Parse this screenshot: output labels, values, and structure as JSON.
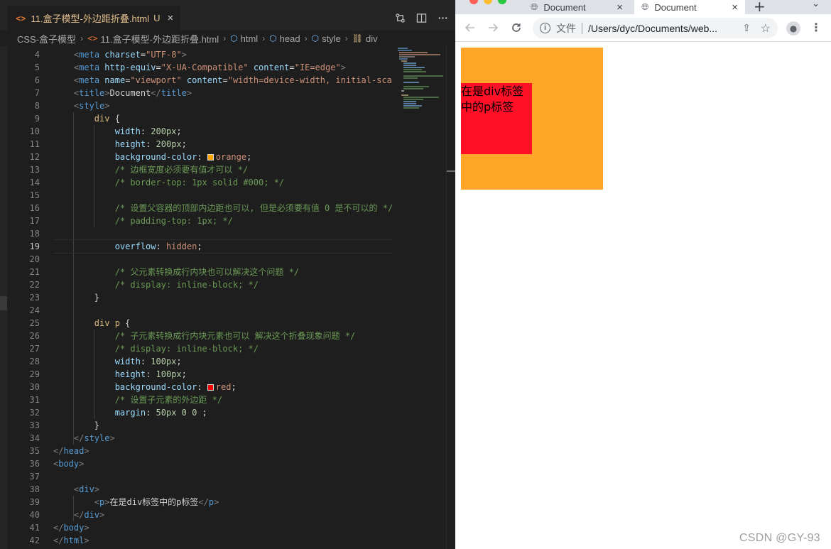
{
  "editor": {
    "tab": {
      "filename": "11.盒子模型-外边距折叠.html",
      "modified": "U",
      "close": "×"
    },
    "actions": [
      "compare",
      "split",
      "more"
    ],
    "breadcrumb": {
      "root": "CSS-盒子模型",
      "file": "11.盒子模型-外边距折叠.html",
      "items": [
        "html",
        "head",
        "style",
        "div"
      ]
    },
    "current_line": 19,
    "line_numbers": [
      "4",
      "5",
      "6",
      "7",
      "8",
      "9",
      "10",
      "11",
      "12",
      "13",
      "14",
      "15",
      "16",
      "17",
      "18",
      "19",
      "20",
      "21",
      "22",
      "23",
      "24",
      "25",
      "26",
      "27",
      "28",
      "29",
      "30",
      "31",
      "32",
      "33",
      "34",
      "35",
      "36",
      "37",
      "38",
      "39",
      "40",
      "41",
      "42"
    ],
    "lines": [
      [
        [
          "    ",
          ""
        ],
        [
          "<",
          "punct"
        ],
        [
          "meta",
          "tag"
        ],
        [
          " ",
          ""
        ],
        [
          "charset",
          "attr"
        ],
        [
          "=",
          "text"
        ],
        [
          "\"UTF-8\"",
          "str"
        ],
        [
          ">",
          "punct"
        ]
      ],
      [
        [
          "    ",
          ""
        ],
        [
          "<",
          "punct"
        ],
        [
          "meta",
          "tag"
        ],
        [
          " ",
          ""
        ],
        [
          "http-equiv",
          "attr"
        ],
        [
          "=",
          "text"
        ],
        [
          "\"X-UA-Compatible\"",
          "str"
        ],
        [
          " ",
          ""
        ],
        [
          "content",
          "attr"
        ],
        [
          "=",
          "text"
        ],
        [
          "\"IE=edge\"",
          "str"
        ],
        [
          ">",
          "punct"
        ]
      ],
      [
        [
          "    ",
          ""
        ],
        [
          "<",
          "punct"
        ],
        [
          "meta",
          "tag"
        ],
        [
          " ",
          ""
        ],
        [
          "name",
          "attr"
        ],
        [
          "=",
          "text"
        ],
        [
          "\"viewport\"",
          "str"
        ],
        [
          " ",
          ""
        ],
        [
          "content",
          "attr"
        ],
        [
          "=",
          "text"
        ],
        [
          "\"width=device-width, initial-sca",
          "str"
        ]
      ],
      [
        [
          "    ",
          ""
        ],
        [
          "<",
          "punct"
        ],
        [
          "title",
          "tag"
        ],
        [
          ">",
          "punct"
        ],
        [
          "Document",
          "text"
        ],
        [
          "</",
          "punct"
        ],
        [
          "title",
          "tag"
        ],
        [
          ">",
          "punct"
        ]
      ],
      [
        [
          "    ",
          ""
        ],
        [
          "<",
          "punct"
        ],
        [
          "style",
          "tag"
        ],
        [
          ">",
          "punct"
        ]
      ],
      [
        [
          "        ",
          ""
        ],
        [
          "div",
          "sel"
        ],
        [
          " {",
          "text"
        ]
      ],
      [
        [
          "            ",
          ""
        ],
        [
          "width",
          "prop"
        ],
        [
          ": ",
          "text"
        ],
        [
          "200px",
          "num"
        ],
        [
          ";",
          "text"
        ]
      ],
      [
        [
          "            ",
          ""
        ],
        [
          "height",
          "prop"
        ],
        [
          ": ",
          "text"
        ],
        [
          "200px",
          "num"
        ],
        [
          ";",
          "text"
        ]
      ],
      [
        [
          "            ",
          ""
        ],
        [
          "background-color",
          "prop"
        ],
        [
          ": ",
          "text"
        ],
        [
          "#ffa500",
          "swatch"
        ],
        [
          "orange",
          "val"
        ],
        [
          ";",
          "text"
        ]
      ],
      [
        [
          "            ",
          ""
        ],
        [
          "/* 边框宽度必须要有值才可以 */",
          "com"
        ]
      ],
      [
        [
          "            ",
          ""
        ],
        [
          "/* border-top: 1px solid #000; */",
          "com"
        ]
      ],
      [
        [
          "",
          ""
        ]
      ],
      [
        [
          "            ",
          ""
        ],
        [
          "/* 设置父容器的顶部内边距也可以, 但是必须要有值 0 是不可以的 */",
          "com"
        ]
      ],
      [
        [
          "            ",
          ""
        ],
        [
          "/* padding-top: 1px; */",
          "com"
        ]
      ],
      [
        [
          "",
          ""
        ]
      ],
      [
        [
          "            ",
          ""
        ],
        [
          "overflow",
          "prop"
        ],
        [
          ": ",
          "text"
        ],
        [
          "hidden",
          "val"
        ],
        [
          ";",
          "text"
        ]
      ],
      [
        [
          "",
          ""
        ]
      ],
      [
        [
          "            ",
          ""
        ],
        [
          "/* 父元素转换成行内块也可以解决这个问题 */",
          "com"
        ]
      ],
      [
        [
          "            ",
          ""
        ],
        [
          "/* display: inline-block; */",
          "com"
        ]
      ],
      [
        [
          "        ",
          ""
        ],
        [
          "}",
          "text"
        ]
      ],
      [
        [
          "",
          ""
        ]
      ],
      [
        [
          "        ",
          ""
        ],
        [
          "div p",
          "sel"
        ],
        [
          " {",
          "text"
        ]
      ],
      [
        [
          "            ",
          ""
        ],
        [
          "/* 子元素转换成行内块元素也可以 解决这个折叠现象问题 */",
          "com"
        ]
      ],
      [
        [
          "            ",
          ""
        ],
        [
          "/* display: inline-block; */",
          "com"
        ]
      ],
      [
        [
          "            ",
          ""
        ],
        [
          "width",
          "prop"
        ],
        [
          ": ",
          "text"
        ],
        [
          "100px",
          "num"
        ],
        [
          ";",
          "text"
        ]
      ],
      [
        [
          "            ",
          ""
        ],
        [
          "height",
          "prop"
        ],
        [
          ": ",
          "text"
        ],
        [
          "100px",
          "num"
        ],
        [
          ";",
          "text"
        ]
      ],
      [
        [
          "            ",
          ""
        ],
        [
          "background-color",
          "prop"
        ],
        [
          ": ",
          "text"
        ],
        [
          "#ff0000",
          "swatch"
        ],
        [
          "red",
          "val"
        ],
        [
          ";",
          "text"
        ]
      ],
      [
        [
          "            ",
          ""
        ],
        [
          "/* 设置子元素的外边距 */",
          "com"
        ]
      ],
      [
        [
          "            ",
          ""
        ],
        [
          "margin",
          "prop"
        ],
        [
          ": ",
          "text"
        ],
        [
          "50px 0 0",
          "num"
        ],
        [
          " ;",
          "text"
        ]
      ],
      [
        [
          "        ",
          ""
        ],
        [
          "}",
          "text"
        ]
      ],
      [
        [
          "    ",
          ""
        ],
        [
          "</",
          "punct"
        ],
        [
          "style",
          "tag"
        ],
        [
          ">",
          "punct"
        ]
      ],
      [
        [
          "</",
          "punct"
        ],
        [
          "head",
          "tag"
        ],
        [
          ">",
          "punct"
        ]
      ],
      [
        [
          "<",
          "punct"
        ],
        [
          "body",
          "tag"
        ],
        [
          ">",
          "punct"
        ]
      ],
      [
        [
          "",
          ""
        ]
      ],
      [
        [
          "    ",
          ""
        ],
        [
          "<",
          "punct"
        ],
        [
          "div",
          "tag"
        ],
        [
          ">",
          "punct"
        ]
      ],
      [
        [
          "        ",
          ""
        ],
        [
          "<",
          "punct"
        ],
        [
          "p",
          "tag"
        ],
        [
          ">",
          "punct"
        ],
        [
          "在是div标签中的p标签",
          "text"
        ],
        [
          "</",
          "punct"
        ],
        [
          "p",
          "tag"
        ],
        [
          ">",
          "punct"
        ]
      ],
      [
        [
          "    ",
          ""
        ],
        [
          "</",
          "punct"
        ],
        [
          "div",
          "tag"
        ],
        [
          ">",
          "punct"
        ]
      ],
      [
        [
          "</",
          "punct"
        ],
        [
          "body",
          "tag"
        ],
        [
          ">",
          "punct"
        ]
      ],
      [
        [
          "</",
          "punct"
        ],
        [
          "html",
          "tag"
        ],
        [
          ">",
          "punct"
        ]
      ]
    ]
  },
  "browser": {
    "tabs": [
      {
        "title": "Document",
        "active": false
      },
      {
        "title": "Document",
        "active": true
      }
    ],
    "new_tab": "+",
    "url_label": "文件",
    "url": "/Users/dyc/Documents/web...",
    "page": {
      "outer_color": "#ffa528",
      "inner_color": "#ff1026",
      "paragraph_text": "在是div标签中的p标签"
    },
    "watermark": "CSDN @GY-93"
  }
}
